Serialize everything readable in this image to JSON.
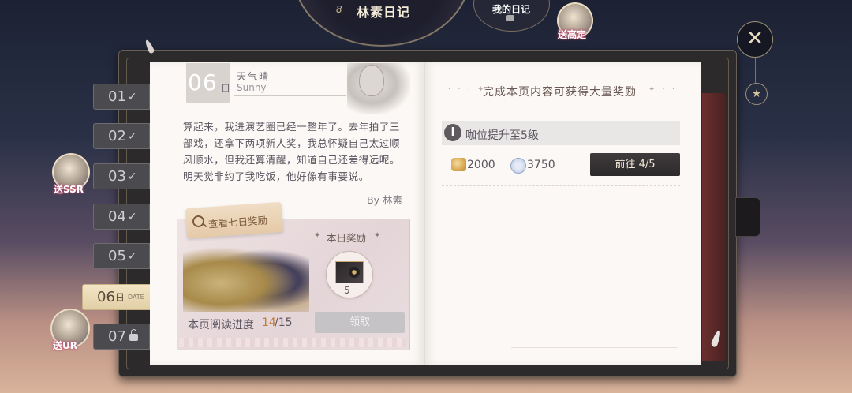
{
  "header": {
    "title": "林素日记",
    "ring_number": "8",
    "my_diary_label": "我的日记",
    "gift_top_label": "送高定"
  },
  "side_gifts": {
    "ssr_label": "送SSR",
    "ur_label": "送UR"
  },
  "day_tabs": [
    {
      "label": "01",
      "state": "completed"
    },
    {
      "label": "02",
      "state": "completed"
    },
    {
      "label": "03",
      "state": "completed"
    },
    {
      "label": "04",
      "state": "completed"
    },
    {
      "label": "05",
      "state": "completed"
    },
    {
      "label": "06",
      "state": "active",
      "suffix": "日",
      "sub": "DATE"
    },
    {
      "label": "07",
      "state": "locked"
    }
  ],
  "left_page": {
    "day_number": "06",
    "day_suffix": "日",
    "weather_cn": "天气晴",
    "weather_en": "Sunny",
    "body": "算起来，我进演艺圈已经一整年了。去年拍了三部戏，还拿下两项新人奖，我总怀疑自己太过顺风顺水，但我还算清醒，知道自己还差得远呢。明天觉非约了我吃饭，他好像有事要说。",
    "byline": "By 林素",
    "view_seven_label": "查看七日奖励",
    "today_reward_label": "本日奖励",
    "reward_count": "5",
    "progress_label": "本页阅读进度",
    "progress_current": "14",
    "progress_total": "/15",
    "claim_label": "领取"
  },
  "right_page": {
    "header": "完成本页内容可获得大量奖励",
    "task_text": "咖位提升至5级",
    "gold_value": "2000",
    "diamond_value": "3750",
    "goto_label": "前往 4/5"
  },
  "colors": {
    "progress_accent": "#c07a3a",
    "active_tab": "#e9d8b2",
    "goto_button": "#2d2a2c"
  }
}
